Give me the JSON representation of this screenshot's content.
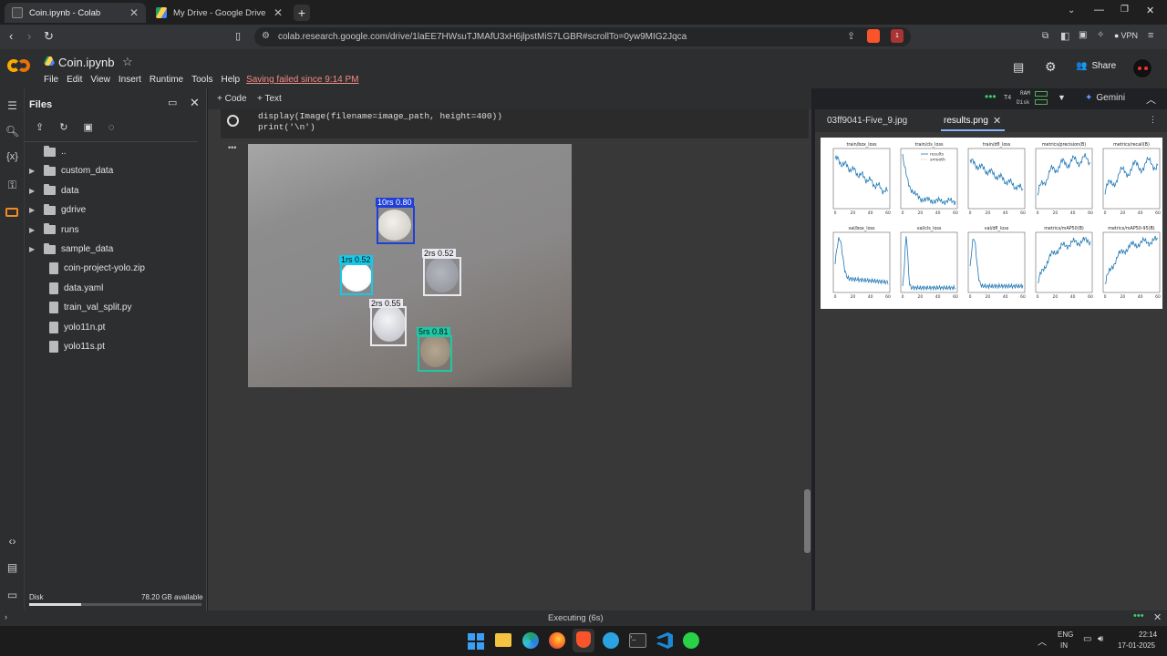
{
  "browser": {
    "tabs": [
      {
        "label": "Coin.ipynb - Colab",
        "active": true
      },
      {
        "label": "My Drive - Google Drive",
        "active": false
      }
    ],
    "url": "colab.research.google.com/drive/1laEE7HWsuTJMAfU3xH6jlpstMiS7LGBR#scrollTo=0yw9MIG2Jqca",
    "vpn": "VPN",
    "badge": "1"
  },
  "colab": {
    "notebook_title": "Coin.ipynb",
    "menu": [
      "File",
      "Edit",
      "View",
      "Insert",
      "Runtime",
      "Tools",
      "Help"
    ],
    "save_status": "Saving failed since 9:14 PM",
    "share": "Share",
    "add_code": "+ Code",
    "add_text": "+ Text",
    "runtime": "T4",
    "ram": "RAM",
    "disk": "Disk",
    "gemini": "Gemini"
  },
  "files": {
    "title": "Files",
    "items": [
      {
        "name": "..",
        "type": "folder",
        "expand": false
      },
      {
        "name": "custom_data",
        "type": "folder",
        "expand": true
      },
      {
        "name": "data",
        "type": "folder",
        "expand": true
      },
      {
        "name": "gdrive",
        "type": "folder",
        "expand": true
      },
      {
        "name": "runs",
        "type": "folder",
        "expand": true
      },
      {
        "name": "sample_data",
        "type": "folder",
        "expand": true
      },
      {
        "name": "coin-project-yolo.zip",
        "type": "file"
      },
      {
        "name": "data.yaml",
        "type": "file"
      },
      {
        "name": "train_val_split.py",
        "type": "file"
      },
      {
        "name": "yolo11n.pt",
        "type": "file"
      },
      {
        "name": "yolo11s.pt",
        "type": "file"
      }
    ],
    "disk_label": "Disk",
    "disk_available": "78.20 GB available",
    "disk_used_fraction": 0.3
  },
  "cell": {
    "lines": [
      "display(Image(filename=image_path, height=400))",
      "print('\\n')"
    ]
  },
  "detections": [
    {
      "label": "10rs",
      "conf": "0.80",
      "color": "#1f3fd6"
    },
    {
      "label": "1rs",
      "conf": "0.52",
      "color": "#18c8e6"
    },
    {
      "label": "2rs",
      "conf": "0.52",
      "color": "#e8e8ee"
    },
    {
      "label": "2rs",
      "conf": "0.55",
      "color": "#e8e8ee"
    },
    {
      "label": "5rs",
      "conf": "0.81",
      "color": "#1cc9a6"
    }
  ],
  "right_pane": {
    "tabs": [
      "03ff9041-Five_9.jpg",
      "results.png"
    ],
    "panels": [
      "train/box_loss",
      "train/cls_loss",
      "train/dfl_loss",
      "metrics/precision(B)",
      "metrics/recall(B)",
      "val/box_loss",
      "val/cls_loss",
      "val/dfl_loss",
      "metrics/mAP50(B)",
      "metrics/mAP50-95(B)"
    ],
    "legend": [
      "results",
      "smooth"
    ]
  },
  "status": {
    "text": "Executing (6s)"
  },
  "taskbar": {
    "lang1": "ENG",
    "lang2": "IN",
    "time": "22:14",
    "date": "17-01-2025"
  }
}
